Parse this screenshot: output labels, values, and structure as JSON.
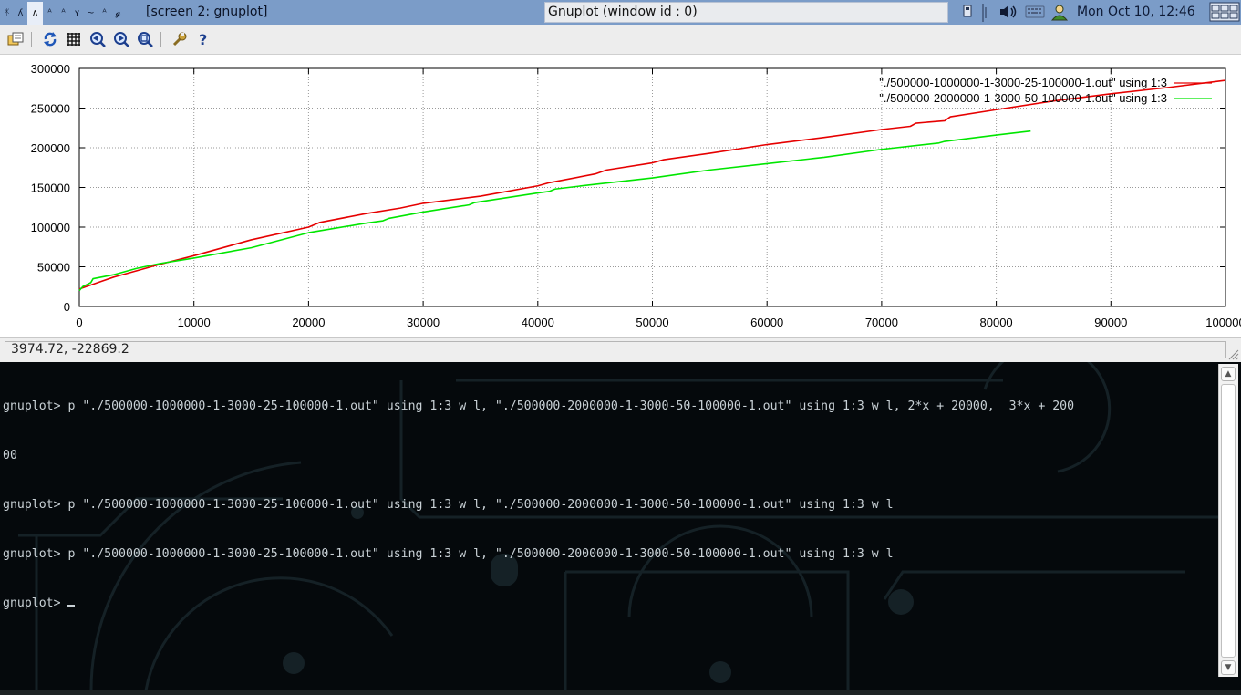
{
  "taskbar": {
    "workspace_glyphs": [
      "ᛡ",
      "ʎ",
      "∧",
      "ᴬ",
      "ᴬ",
      "ʏ",
      "~",
      "ᴬ",
      "𝓰"
    ],
    "window_title": "[screen 2: gnuplot]",
    "focused_window": "Gnuplot (window id : 0)",
    "clock": "Mon Oct 10, 12:46",
    "colors": {
      "bar": "#7b9cc8",
      "active_tab": "#e8eef8"
    }
  },
  "toolbar": {
    "buttons": [
      "copy-to-clipboard-icon",
      "replot-icon",
      "grid-icon",
      "zoom-previous-icon",
      "zoom-next-icon",
      "autoscale-icon",
      "configure-icon",
      "help-icon"
    ]
  },
  "chart_data": {
    "type": "line",
    "title": "",
    "xlabel": "",
    "ylabel": "",
    "xlim": [
      0,
      100000
    ],
    "ylim": [
      0,
      300000
    ],
    "grid": true,
    "legend_position": "top-right",
    "x_ticks": [
      "0",
      "10000",
      "20000",
      "30000",
      "40000",
      "50000",
      "60000",
      "70000",
      "80000",
      "90000",
      "100000"
    ],
    "y_ticks": [
      "0",
      "50000",
      "100000",
      "150000",
      "200000",
      "250000",
      "300000"
    ],
    "series": [
      {
        "name": "\"./500000-1000000-1-3000-25-100000-1.out\" using 1:3",
        "color": "#e60000",
        "x": [
          0,
          1000,
          2000,
          3000,
          5000,
          7000,
          10000,
          15000,
          20000,
          21000,
          25000,
          28000,
          30000,
          35000,
          40000,
          41000,
          45000,
          46000,
          50000,
          51000,
          55000,
          60000,
          65000,
          70000,
          72500,
          73000,
          75500,
          76000,
          80000,
          85000,
          90000,
          95000,
          100000
        ],
        "values": [
          22000,
          27000,
          32000,
          37000,
          45000,
          53000,
          64000,
          84000,
          100000,
          106000,
          117000,
          124000,
          130000,
          139000,
          152000,
          156000,
          167000,
          172000,
          181000,
          185000,
          193000,
          204000,
          213000,
          223000,
          227000,
          231000,
          234000,
          239000,
          248000,
          259000,
          268000,
          276000,
          285000
        ]
      },
      {
        "name": "\"./500000-2000000-1-3000-50-100000-1.out\" using 1:3",
        "color": "#00e600",
        "x": [
          0,
          300,
          1000,
          1200,
          3000,
          5000,
          7000,
          10000,
          15000,
          20000,
          25000,
          26500,
          27000,
          30000,
          34000,
          34500,
          40000,
          41000,
          41500,
          45000,
          50000,
          55000,
          60000,
          65000,
          70000,
          75000,
          75500,
          80000,
          83000
        ],
        "values": [
          20000,
          25000,
          30000,
          35000,
          40000,
          48000,
          54000,
          61000,
          74000,
          93000,
          105000,
          108000,
          111000,
          119000,
          128000,
          131000,
          143000,
          145000,
          148000,
          154000,
          162000,
          172000,
          180000,
          188000,
          198000,
          206000,
          208000,
          216000,
          221000
        ]
      }
    ]
  },
  "status": {
    "coords": "3974.72, -22869.2"
  },
  "terminal": {
    "lines": [
      "gnuplot> p \"./500000-1000000-1-3000-25-100000-1.out\" using 1:3 w l, \"./500000-2000000-1-3000-50-100000-1.out\" using 1:3 w l, 2*x + 20000,  3*x + 200",
      "00",
      "gnuplot> p \"./500000-1000000-1-3000-25-100000-1.out\" using 1:3 w l, \"./500000-2000000-1-3000-50-100000-1.out\" using 1:3 w l",
      "gnuplot> p \"./500000-1000000-1-3000-25-100000-1.out\" using 1:3 w l, \"./500000-2000000-1-3000-50-100000-1.out\" using 1:3 w l",
      "gnuplot> "
    ],
    "text_color": "#c9d1d6",
    "background": "#05090c"
  }
}
